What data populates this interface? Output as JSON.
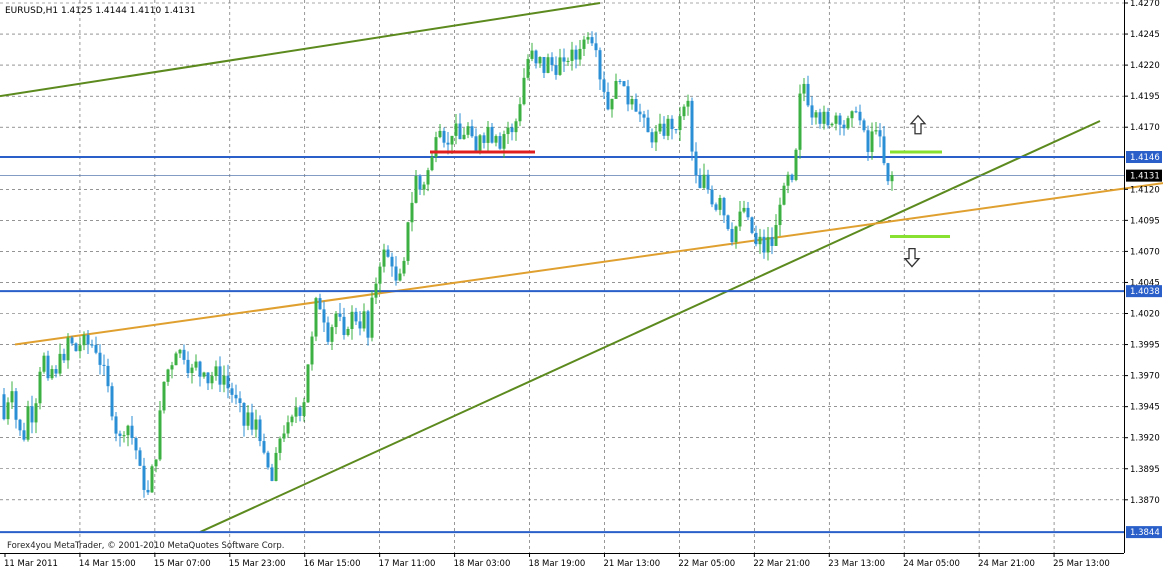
{
  "symbol_header": "EURUSD,H1  1.4125 1.4144 1.4110 1.4131",
  "copyright": "Forex4you MetaTrader, © 2001-2010 MetaQuotes Software Corp.",
  "colors": {
    "background": "#ffffff",
    "grid": "#555555",
    "bull_candle": "#3cb043",
    "bear_candle": "#2b8fd6",
    "horizontal_level": "#2a5fc9",
    "last_price_line": "#5a7bb0",
    "trend_green": "#5c8a1e",
    "trend_orange": "#e0a030",
    "support_red": "#e02020",
    "target_lime": "#88e030",
    "arrow": "#333333"
  },
  "chart_data": {
    "type": "candlestick",
    "symbol": "EURUSD",
    "timeframe": "H1",
    "ohlc_header": {
      "open": 1.4125,
      "high": 1.4144,
      "low": 1.411,
      "close": 1.4131
    },
    "ylim": [
      1.3832,
      1.427
    ],
    "y_ticks": [
      "1.4270",
      "1.4245",
      "1.4220",
      "1.4195",
      "1.4170",
      "1.4146",
      "1.4131",
      "1.4120",
      "1.4095",
      "1.4070",
      "1.4045",
      "1.4038",
      "1.4020",
      "1.3995",
      "1.3970",
      "1.3945",
      "1.3920",
      "1.3895",
      "1.3870",
      "1.3844"
    ],
    "x_ticks": [
      "11 Mar 2011",
      "14 Mar 15:00",
      "15 Mar 07:00",
      "15 Mar 23:00",
      "16 Mar 15:00",
      "17 Mar 11:00",
      "18 Mar 03:00",
      "18 Mar 19:00",
      "21 Mar 13:00",
      "22 Mar 05:00",
      "22 Mar 21:00",
      "23 Mar 13:00",
      "24 Mar 05:00",
      "24 Mar 21:00",
      "25 Mar 13:00"
    ],
    "grid": true,
    "path_points": [
      [
        1.3955,
        0
      ],
      [
        1.3935,
        4
      ],
      [
        1.395,
        8
      ],
      [
        1.396,
        12
      ],
      [
        1.3935,
        16
      ],
      [
        1.3925,
        20
      ],
      [
        1.392,
        24
      ],
      [
        1.3945,
        28
      ],
      [
        1.3935,
        32
      ],
      [
        1.395,
        36
      ],
      [
        1.3975,
        40
      ],
      [
        1.3985,
        44
      ],
      [
        1.3965,
        48
      ],
      [
        1.3975,
        52
      ],
      [
        1.397,
        56
      ],
      [
        1.399,
        60
      ],
      [
        1.398,
        64
      ],
      [
        1.4,
        68
      ],
      [
        1.3995,
        72
      ],
      [
        1.399,
        76
      ],
      [
        1.3995,
        80
      ],
      [
        1.4,
        84
      ],
      [
        1.3995,
        88
      ],
      [
        1.3995,
        92
      ],
      [
        1.399,
        96
      ],
      [
        1.398,
        100
      ],
      [
        1.3975,
        104
      ],
      [
        1.396,
        108
      ],
      [
        1.394,
        112
      ],
      [
        1.3925,
        116
      ],
      [
        1.392,
        120
      ],
      [
        1.3925,
        124
      ],
      [
        1.393,
        128
      ],
      [
        1.392,
        132
      ],
      [
        1.391,
        136
      ],
      [
        1.3895,
        140
      ],
      [
        1.388,
        144
      ],
      [
        1.3875,
        148
      ],
      [
        1.3895,
        152
      ],
      [
        1.3905,
        156
      ],
      [
        1.394,
        160
      ],
      [
        1.3965,
        164
      ],
      [
        1.3975,
        168
      ],
      [
        1.398,
        172
      ],
      [
        1.399,
        176
      ],
      [
        1.399,
        180
      ],
      [
        1.3985,
        184
      ],
      [
        1.3975,
        188
      ],
      [
        1.3975,
        192
      ],
      [
        1.398,
        196
      ],
      [
        1.397,
        200
      ],
      [
        1.3975,
        204
      ],
      [
        1.3965,
        208
      ],
      [
        1.397,
        212
      ],
      [
        1.3975,
        216
      ],
      [
        1.3965,
        220
      ],
      [
        1.397,
        224
      ],
      [
        1.396,
        228
      ],
      [
        1.3955,
        232
      ],
      [
        1.395,
        236
      ],
      [
        1.3945,
        240
      ],
      [
        1.393,
        244
      ],
      [
        1.394,
        248
      ],
      [
        1.3925,
        252
      ],
      [
        1.3935,
        256
      ],
      [
        1.392,
        260
      ],
      [
        1.3905,
        264
      ],
      [
        1.3895,
        268
      ],
      [
        1.3885,
        272
      ],
      [
        1.3905,
        276
      ],
      [
        1.392,
        280
      ],
      [
        1.3925,
        284
      ],
      [
        1.393,
        288
      ],
      [
        1.3935,
        292
      ],
      [
        1.3945,
        296
      ],
      [
        1.394,
        300
      ],
      [
        1.395,
        304
      ],
      [
        1.398,
        308
      ],
      [
        1.4,
        312
      ],
      [
        1.403,
        316
      ],
      [
        1.4025,
        320
      ],
      [
        1.4015,
        324
      ],
      [
        1.4,
        328
      ],
      [
        1.401,
        332
      ],
      [
        1.402,
        336
      ],
      [
        1.4015,
        340
      ],
      [
        1.4,
        344
      ],
      [
        1.401,
        348
      ],
      [
        1.402,
        352
      ],
      [
        1.4015,
        356
      ],
      [
        1.401,
        360
      ],
      [
        1.402,
        364
      ],
      [
        1.4,
        368
      ],
      [
        1.403,
        372
      ],
      [
        1.4045,
        376
      ],
      [
        1.406,
        380
      ],
      [
        1.407,
        384
      ],
      [
        1.4065,
        388
      ],
      [
        1.406,
        392
      ],
      [
        1.4045,
        396
      ],
      [
        1.405,
        400
      ],
      [
        1.406,
        404
      ],
      [
        1.4095,
        408
      ],
      [
        1.411,
        412
      ],
      [
        1.413,
        416
      ],
      [
        1.412,
        420
      ],
      [
        1.4125,
        424
      ],
      [
        1.4135,
        428
      ],
      [
        1.4145,
        432
      ],
      [
        1.4165,
        436
      ],
      [
        1.417,
        440
      ],
      [
        1.416,
        444
      ],
      [
        1.4155,
        448
      ],
      [
        1.4165,
        452
      ],
      [
        1.417,
        456
      ],
      [
        1.416,
        460
      ],
      [
        1.4165,
        464
      ],
      [
        1.417,
        468
      ],
      [
        1.416,
        472
      ],
      [
        1.415,
        476
      ],
      [
        1.4165,
        480
      ],
      [
        1.416,
        484
      ],
      [
        1.417,
        488
      ],
      [
        1.416,
        492
      ],
      [
        1.4165,
        496
      ],
      [
        1.4155,
        500
      ],
      [
        1.4165,
        504
      ],
      [
        1.417,
        508
      ],
      [
        1.4165,
        512
      ],
      [
        1.4175,
        516
      ],
      [
        1.419,
        520
      ],
      [
        1.421,
        524
      ],
      [
        1.4225,
        528
      ],
      [
        1.423,
        532
      ],
      [
        1.422,
        536
      ],
      [
        1.4225,
        540
      ],
      [
        1.4215,
        544
      ],
      [
        1.4225,
        548
      ],
      [
        1.422,
        552
      ],
      [
        1.4215,
        556
      ],
      [
        1.4225,
        560
      ],
      [
        1.422,
        564
      ],
      [
        1.4225,
        568
      ],
      [
        1.423,
        572
      ],
      [
        1.4225,
        576
      ],
      [
        1.4235,
        580
      ],
      [
        1.424,
        584
      ],
      [
        1.4245,
        588
      ],
      [
        1.424,
        592
      ],
      [
        1.4235,
        596
      ],
      [
        1.421,
        600
      ],
      [
        1.42,
        604
      ],
      [
        1.4185,
        608
      ],
      [
        1.4195,
        612
      ],
      [
        1.4205,
        616
      ],
      [
        1.421,
        620
      ],
      [
        1.42,
        624
      ],
      [
        1.419,
        628
      ],
      [
        1.4195,
        632
      ],
      [
        1.4185,
        636
      ],
      [
        1.418,
        640
      ],
      [
        1.4175,
        644
      ],
      [
        1.4165,
        648
      ],
      [
        1.416,
        652
      ],
      [
        1.4165,
        656
      ],
      [
        1.417,
        660
      ],
      [
        1.4165,
        664
      ],
      [
        1.4175,
        668
      ],
      [
        1.417,
        672
      ],
      [
        1.4165,
        676
      ],
      [
        1.418,
        680
      ],
      [
        1.4185,
        684
      ],
      [
        1.419,
        688
      ],
      [
        1.415,
        692
      ],
      [
        1.413,
        696
      ],
      [
        1.412,
        700
      ],
      [
        1.413,
        704
      ],
      [
        1.412,
        708
      ],
      [
        1.411,
        712
      ],
      [
        1.4105,
        716
      ],
      [
        1.4115,
        720
      ],
      [
        1.41,
        724
      ],
      [
        1.409,
        728
      ],
      [
        1.408,
        732
      ],
      [
        1.409,
        736
      ],
      [
        1.41,
        740
      ],
      [
        1.4105,
        744
      ],
      [
        1.4095,
        748
      ],
      [
        1.4085,
        752
      ],
      [
        1.4075,
        756
      ],
      [
        1.408,
        760
      ],
      [
        1.407,
        764
      ],
      [
        1.408,
        768
      ],
      [
        1.4075,
        772
      ],
      [
        1.409,
        776
      ],
      [
        1.411,
        780
      ],
      [
        1.412,
        784
      ],
      [
        1.413,
        788
      ],
      [
        1.4125,
        792
      ],
      [
        1.415,
        796
      ],
      [
        1.4195,
        800
      ],
      [
        1.4205,
        804
      ],
      [
        1.419,
        808
      ],
      [
        1.418,
        812
      ],
      [
        1.4185,
        816
      ],
      [
        1.4175,
        820
      ],
      [
        1.418,
        824
      ],
      [
        1.417,
        828
      ],
      [
        1.4175,
        832
      ],
      [
        1.418,
        836
      ],
      [
        1.4175,
        840
      ],
      [
        1.417,
        844
      ],
      [
        1.4175,
        848
      ],
      [
        1.418,
        852
      ],
      [
        1.4185,
        856
      ],
      [
        1.4175,
        860
      ],
      [
        1.4165,
        864
      ],
      [
        1.415,
        868
      ],
      [
        1.4165,
        872
      ],
      [
        1.417,
        876
      ],
      [
        1.416,
        880
      ],
      [
        1.414,
        884
      ],
      [
        1.4125,
        888
      ],
      [
        1.4131,
        892
      ]
    ],
    "horizontal_levels": [
      {
        "price": 1.4146,
        "label": "1.4146"
      },
      {
        "price": 1.4038,
        "label": "1.4038"
      },
      {
        "price": 1.3844,
        "label": "1.3844"
      }
    ],
    "last_price": {
      "price": 1.4131,
      "label": "1.4131"
    },
    "trendlines": [
      {
        "color": "trend_green",
        "from": [
          1.4195,
          0
        ],
        "to": [
          1.427,
          600
        ]
      },
      {
        "color": "trend_green",
        "from": [
          1.3844,
          200
        ],
        "to": [
          1.4175,
          1100
        ]
      },
      {
        "color": "trend_orange",
        "from": [
          1.3995,
          15
        ],
        "to": [
          1.4125,
          1163
        ]
      }
    ],
    "segments": [
      {
        "color": "support_red",
        "price": 1.415,
        "from": 430,
        "to": 535
      },
      {
        "color": "target_lime",
        "price": 1.415,
        "from": 890,
        "to": 942
      },
      {
        "color": "target_lime",
        "price": 1.4082,
        "from": 890,
        "to": 950
      }
    ],
    "arrows": [
      {
        "direction": "up",
        "x": 918,
        "price": 1.4172
      },
      {
        "direction": "down",
        "x": 912,
        "price": 1.4065
      }
    ]
  }
}
